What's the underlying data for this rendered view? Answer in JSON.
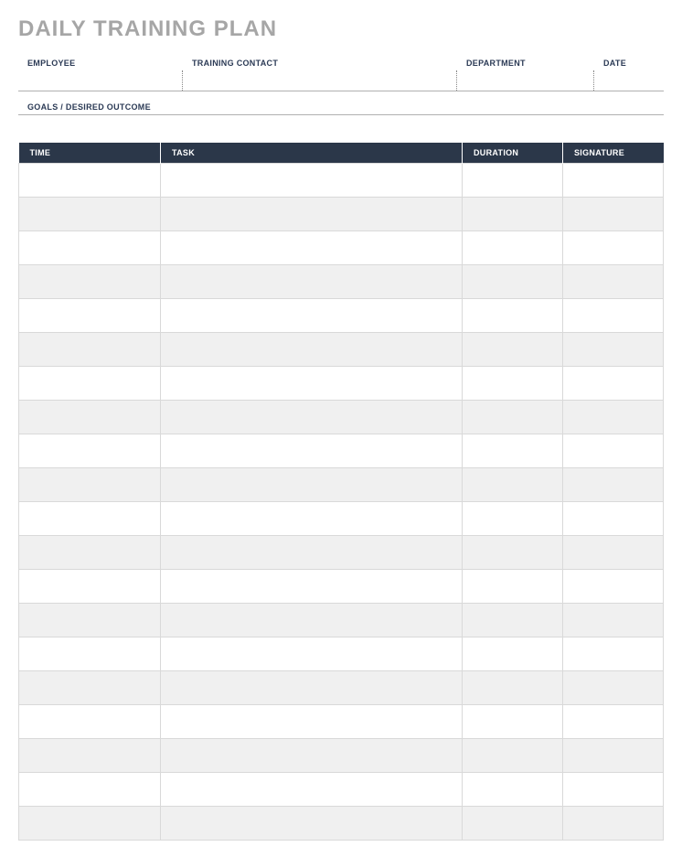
{
  "title": "DAILY TRAINING PLAN",
  "info": {
    "employee_label": "EMPLOYEE",
    "employee_value": "",
    "contact_label": "TRAINING CONTACT",
    "contact_value": "",
    "department_label": "DEPARTMENT",
    "department_value": "",
    "date_label": "DATE",
    "date_value": "",
    "goals_label": "GOALS / DESIRED OUTCOME",
    "goals_value": ""
  },
  "table": {
    "headers": {
      "time": "TIME",
      "task": "TASK",
      "duration": "DURATION",
      "signature": "SIGNATURE"
    },
    "rows": [
      {
        "time": "",
        "task": "",
        "duration": "",
        "signature": ""
      },
      {
        "time": "",
        "task": "",
        "duration": "",
        "signature": ""
      },
      {
        "time": "",
        "task": "",
        "duration": "",
        "signature": ""
      },
      {
        "time": "",
        "task": "",
        "duration": "",
        "signature": ""
      },
      {
        "time": "",
        "task": "",
        "duration": "",
        "signature": ""
      },
      {
        "time": "",
        "task": "",
        "duration": "",
        "signature": ""
      },
      {
        "time": "",
        "task": "",
        "duration": "",
        "signature": ""
      },
      {
        "time": "",
        "task": "",
        "duration": "",
        "signature": ""
      },
      {
        "time": "",
        "task": "",
        "duration": "",
        "signature": ""
      },
      {
        "time": "",
        "task": "",
        "duration": "",
        "signature": ""
      },
      {
        "time": "",
        "task": "",
        "duration": "",
        "signature": ""
      },
      {
        "time": "",
        "task": "",
        "duration": "",
        "signature": ""
      },
      {
        "time": "",
        "task": "",
        "duration": "",
        "signature": ""
      },
      {
        "time": "",
        "task": "",
        "duration": "",
        "signature": ""
      },
      {
        "time": "",
        "task": "",
        "duration": "",
        "signature": ""
      },
      {
        "time": "",
        "task": "",
        "duration": "",
        "signature": ""
      },
      {
        "time": "",
        "task": "",
        "duration": "",
        "signature": ""
      },
      {
        "time": "",
        "task": "",
        "duration": "",
        "signature": ""
      },
      {
        "time": "",
        "task": "",
        "duration": "",
        "signature": ""
      },
      {
        "time": "",
        "task": "",
        "duration": "",
        "signature": ""
      }
    ]
  }
}
